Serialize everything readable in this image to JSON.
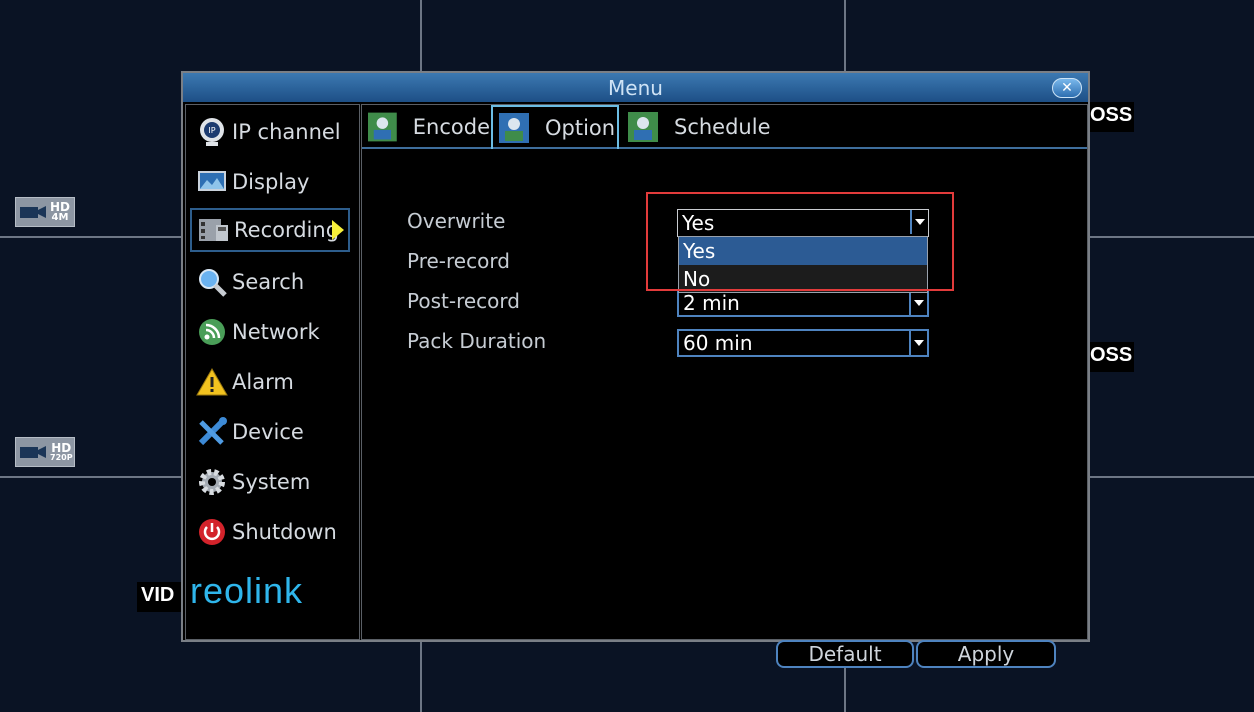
{
  "window": {
    "title": "Menu"
  },
  "sidebar": {
    "items": [
      {
        "label": "IP channel",
        "icon": "ip-camera-icon"
      },
      {
        "label": "Display",
        "icon": "monitor-icon"
      },
      {
        "label": "Recording",
        "icon": "film-icon",
        "active": true
      },
      {
        "label": "Search",
        "icon": "magnifier-icon"
      },
      {
        "label": "Network",
        "icon": "network-icon"
      },
      {
        "label": "Alarm",
        "icon": "warning-icon"
      },
      {
        "label": "Device",
        "icon": "tools-icon"
      },
      {
        "label": "System",
        "icon": "gear-icon"
      },
      {
        "label": "Shutdown",
        "icon": "power-icon"
      }
    ],
    "logo": "reolink"
  },
  "tabs": [
    {
      "label": "Encode"
    },
    {
      "label": "Option",
      "selected": true
    },
    {
      "label": "Schedule"
    }
  ],
  "form": {
    "overwrite": {
      "label": "Overwrite",
      "value": "Yes"
    },
    "prerecord": {
      "label": "Pre-record"
    },
    "postrecord": {
      "label": "Post-record",
      "value": "2 min"
    },
    "pack": {
      "label": "Pack Duration",
      "value": "60 min"
    }
  },
  "dropdown": {
    "options": [
      "Yes",
      "No"
    ],
    "highlighted": "Yes"
  },
  "buttons": {
    "default": "Default",
    "apply": "Apply"
  },
  "background": {
    "badge1": {
      "top": "HD",
      "bottom": "4M"
    },
    "badge2": {
      "top": "HD",
      "bottom": "720P"
    },
    "overlay_text_1": "OSS",
    "overlay_text_2": "OSS",
    "overlay_text_3": "VID"
  },
  "colors": {
    "accent": "#4e83bf",
    "highlight_box": "#e23b3b",
    "titlebar": "#2a64a0",
    "arrow": "#f7ef3a",
    "logo": "#2fb6ec"
  }
}
